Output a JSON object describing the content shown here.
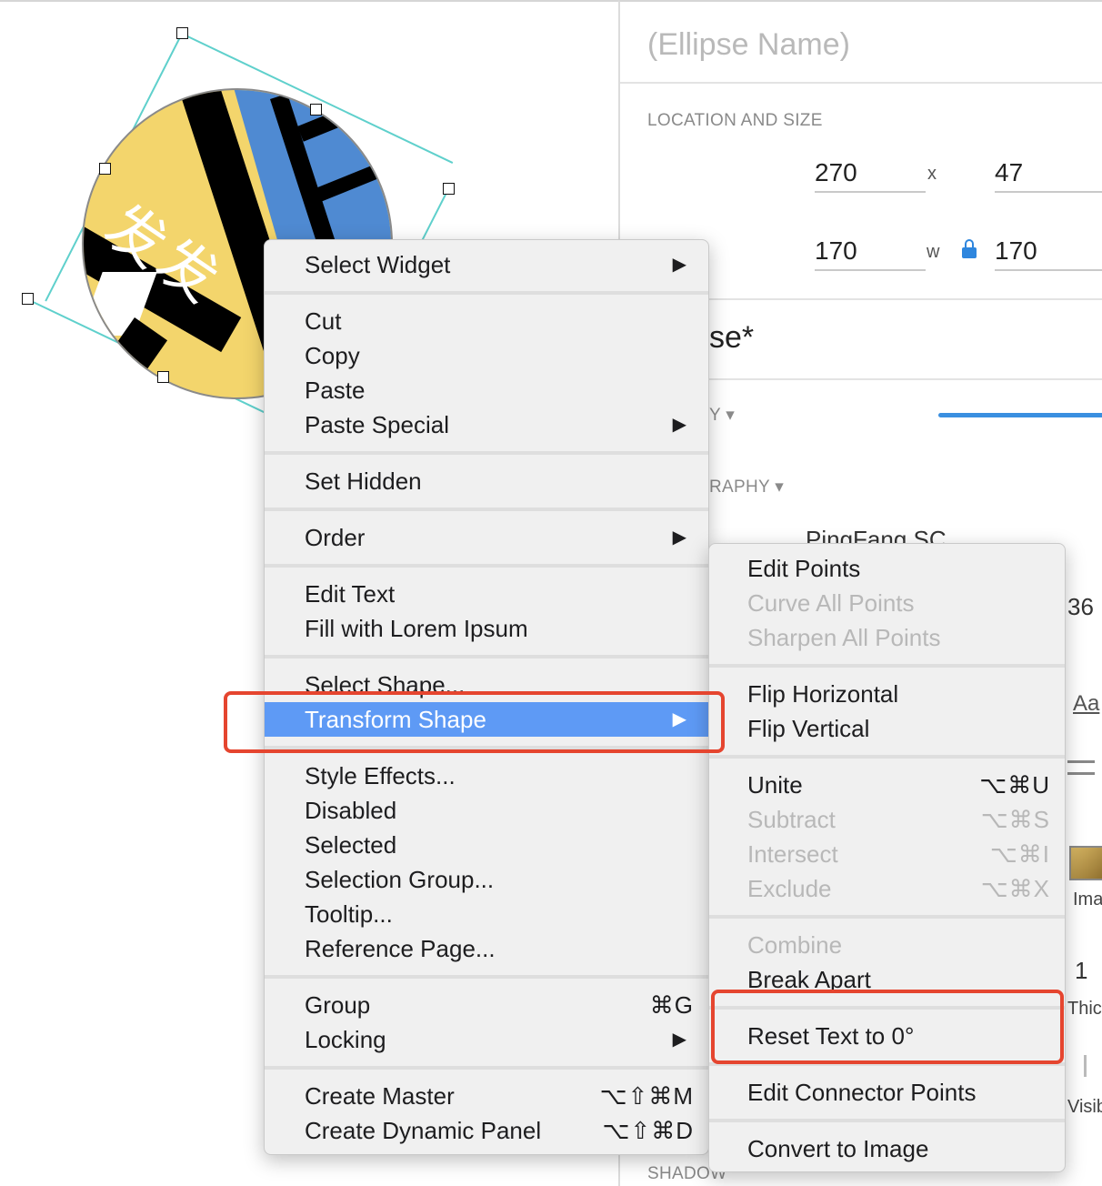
{
  "panel": {
    "ellipse_name_placeholder": "(Ellipse Name)",
    "location_size_label": "LOCATION AND SIZE",
    "x": "270",
    "x_label": "x",
    "y": "47",
    "w": "170",
    "w_label": "w",
    "h": "170",
    "widget_title_fragment": "se*",
    "opacity_label_fragment": "Y ▾",
    "typography_label_fragment": "RAPHY ▾",
    "font_name": "PingFang SC",
    "font_size_fragment": "36",
    "aa_icon": "Aa",
    "image_label_fragment": "Ima",
    "thickness_value": "1",
    "thickness_label_fragment": "Thick",
    "visibility_label_fragment": "Visib",
    "shadow_label_fragment": "SHADOW"
  },
  "canvas": {
    "widget_text": "发发"
  },
  "context_menu": {
    "items": [
      {
        "label": "Select Widget",
        "submenu": true
      },
      {
        "label": "Cut"
      },
      {
        "label": "Copy"
      },
      {
        "label": "Paste"
      },
      {
        "label": "Paste Special",
        "submenu": true
      },
      {
        "label": "Set Hidden"
      },
      {
        "label": "Order",
        "submenu": true
      },
      {
        "label": "Edit Text"
      },
      {
        "label": "Fill with Lorem Ipsum"
      },
      {
        "label": "Select Shape..."
      },
      {
        "label": "Transform Shape",
        "submenu": true,
        "active": true
      },
      {
        "label": "Style Effects..."
      },
      {
        "label": "Disabled"
      },
      {
        "label": "Selected"
      },
      {
        "label": "Selection Group..."
      },
      {
        "label": "Tooltip..."
      },
      {
        "label": "Reference Page..."
      },
      {
        "label": "Group",
        "shortcut": "⌘G"
      },
      {
        "label": "Locking",
        "submenu": true
      },
      {
        "label": "Create Master",
        "shortcut": "⌥⇧⌘M"
      },
      {
        "label": "Create Dynamic Panel",
        "shortcut": "⌥⇧⌘D"
      }
    ],
    "arrow": "▶"
  },
  "submenu": {
    "items": [
      {
        "label": "Edit Points"
      },
      {
        "label": "Curve All Points",
        "disabled": true
      },
      {
        "label": "Sharpen All Points",
        "disabled": true
      },
      {
        "label": "Flip Horizontal"
      },
      {
        "label": "Flip Vertical"
      },
      {
        "label": "Unite",
        "shortcut": "⌥⌘U"
      },
      {
        "label": "Subtract",
        "shortcut": "⌥⌘S",
        "disabled": true
      },
      {
        "label": "Intersect",
        "shortcut": "⌥⌘I",
        "disabled": true
      },
      {
        "label": "Exclude",
        "shortcut": "⌥⌘X",
        "disabled": true
      },
      {
        "label": "Combine",
        "disabled": true
      },
      {
        "label": "Break Apart"
      },
      {
        "label": "Reset Text to 0°"
      },
      {
        "label": "Edit Connector Points"
      },
      {
        "label": "Convert to Image"
      }
    ]
  },
  "colors": {
    "highlight_box": "#e5452f",
    "active_item": "#5e9af5",
    "selection_outline": "#5fd0cc"
  }
}
